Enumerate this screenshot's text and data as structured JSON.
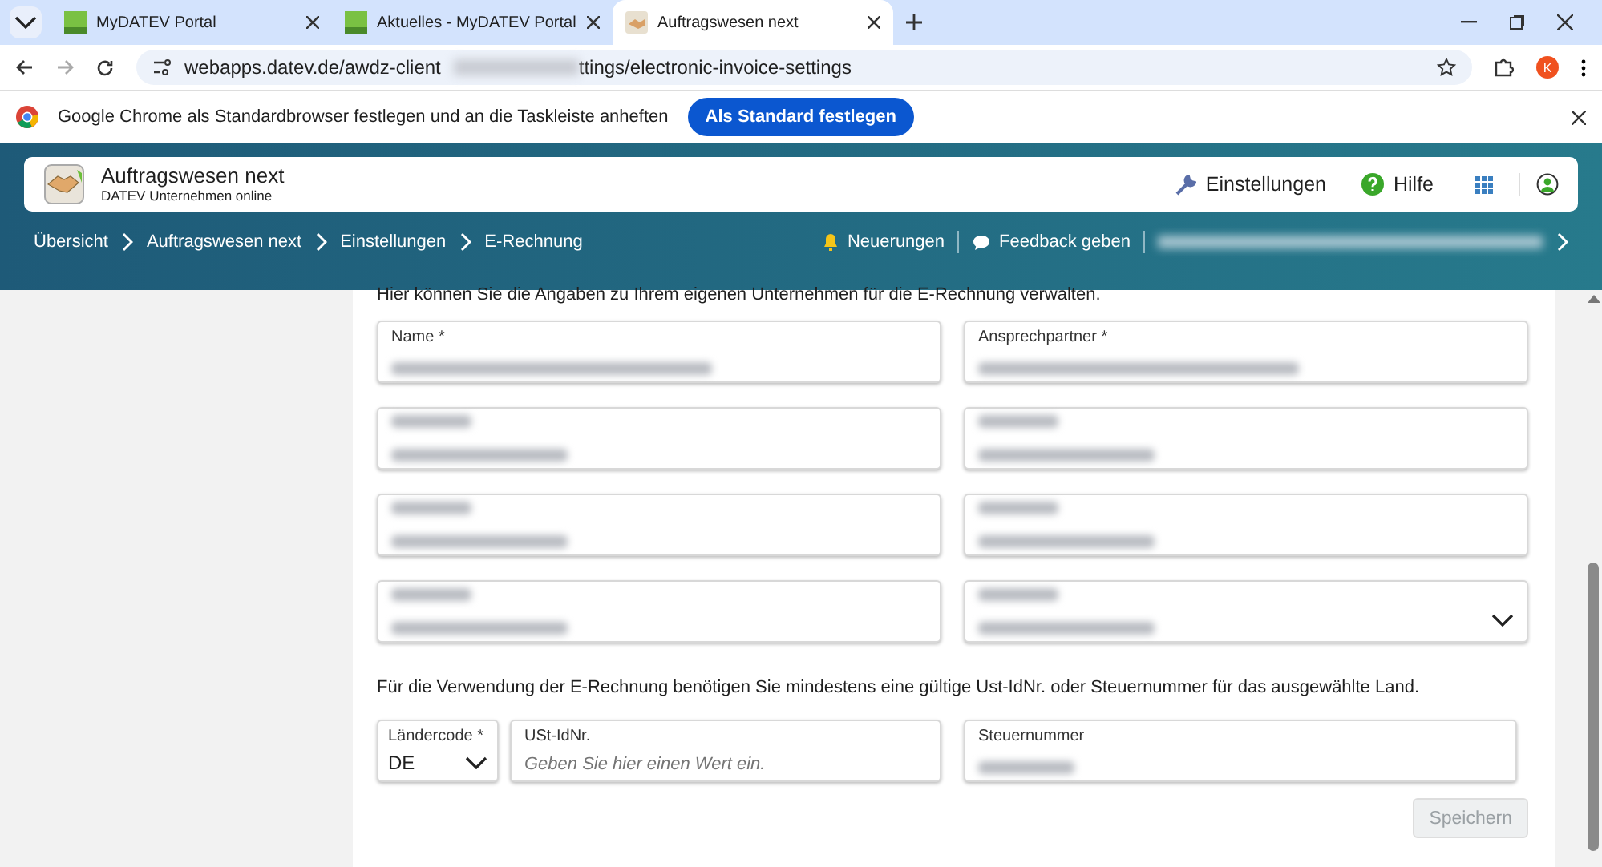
{
  "browser": {
    "tabs": [
      {
        "title": "MyDATEV Portal",
        "selected": false
      },
      {
        "title": "Aktuelles - MyDATEV Portal",
        "selected": false
      },
      {
        "title": "Auftragswesen next",
        "selected": true
      }
    ],
    "url_start": "webapps.datev.de/awdz-client",
    "url_end": "ttings/electronic-invoice-settings",
    "infobar": {
      "text": "Google Chrome als Standardbrowser festlegen und an die Taskleiste anheften",
      "button": "Als Standard festlegen"
    },
    "profile_initial": "K"
  },
  "app": {
    "title": "Auftragswesen next",
    "subtitle": "DATEV Unternehmen online",
    "actions": [
      {
        "label": "Einstellungen",
        "kind": "settings"
      },
      {
        "label": "Hilfe",
        "kind": "help"
      }
    ],
    "breadcrumbs": [
      "Übersicht",
      "Auftragswesen next",
      "Einstellungen",
      "E-Rechnung"
    ],
    "links": [
      {
        "label": "Neuerungen",
        "kind": "bell"
      },
      {
        "label": "Feedback geben",
        "kind": "chat"
      }
    ]
  },
  "form": {
    "intro": "Hier können Sie die Angaben zu Ihrem eigenen Unternehmen für die E-Rechnung verwalten.",
    "fields": [
      {
        "label": "Name *",
        "kind": "text"
      },
      {
        "label": "Ansprechpartner *",
        "kind": "text"
      },
      {
        "kind": "text"
      },
      {
        "kind": "text"
      },
      {
        "kind": "text"
      },
      {
        "kind": "text"
      },
      {
        "kind": "text"
      },
      {
        "kind": "select"
      }
    ],
    "note": "Für die Verwendung der E-Rechnung benötigen Sie mindestens eine gültige Ust-IdNr. oder Steuernummer für das ausgewählte Land.",
    "country_code": {
      "label": "Ländercode *",
      "value": "DE"
    },
    "vat_id": {
      "label": "USt-IdNr.",
      "placeholder": "Geben Sie hier einen Wert ein."
    },
    "tax_number": {
      "label": "Steuernummer"
    },
    "save": {
      "label": "Speichern",
      "disabled": true
    }
  }
}
